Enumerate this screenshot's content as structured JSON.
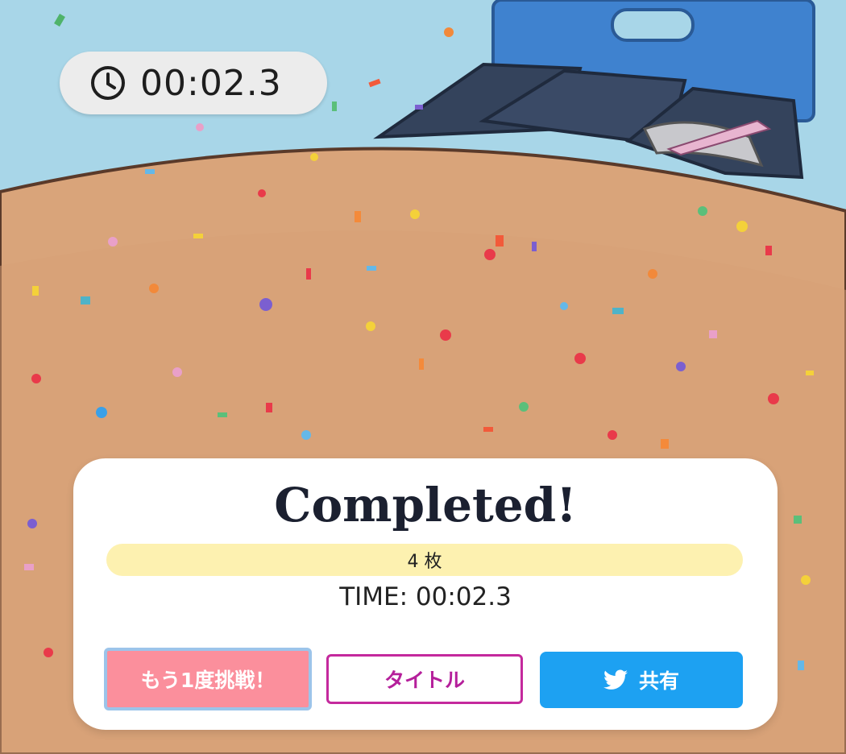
{
  "timer": {
    "text": "00:02.3",
    "icon": "clock-icon"
  },
  "result": {
    "title": "Completed!",
    "count": "4 枚",
    "time": "TIME: 00:02.3"
  },
  "buttons": {
    "retry": "もう1度挑戦！",
    "title_screen": "タイトル",
    "share": "共有",
    "share_icon": "twitter-bird-icon"
  },
  "colors": {
    "sky": "#a8d6e8",
    "table": "#d9a47a",
    "retry_button": "#fb8f9c",
    "title_button_border": "#c4299d",
    "share_button": "#1da1f2",
    "count_bar": "#fdf1b0"
  }
}
